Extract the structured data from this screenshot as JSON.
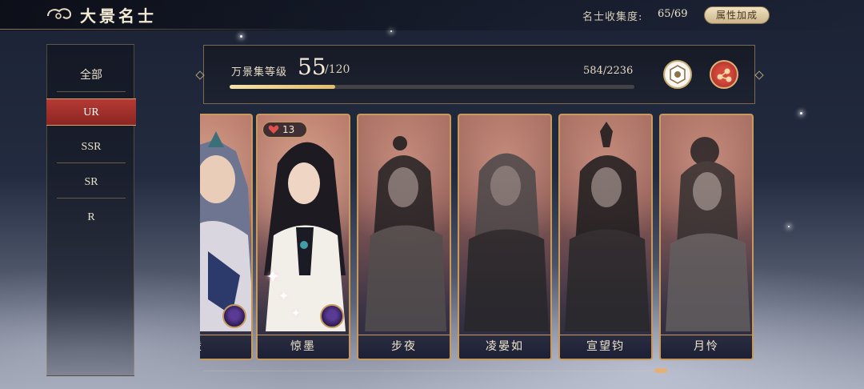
{
  "header": {
    "title": "大景名士",
    "collection_label": "名士收集度:",
    "collection_value": "65/69",
    "attribute_button": "属性加成"
  },
  "sidebar": {
    "items": [
      {
        "label": "全部",
        "active": false
      },
      {
        "label": "UR",
        "active": true
      },
      {
        "label": "SSR",
        "active": false
      },
      {
        "label": "SR",
        "active": false
      },
      {
        "label": "R",
        "active": false
      }
    ]
  },
  "level": {
    "label": "万景集等级",
    "value": "55",
    "max": "/120",
    "exp": "584/2236",
    "exp_progress": 0.26
  },
  "cards": [
    {
      "name": "凌",
      "owned": true,
      "heart": null
    },
    {
      "name": "惊墨",
      "owned": true,
      "heart": "13"
    },
    {
      "name": "步夜",
      "owned": false,
      "heart": null
    },
    {
      "name": "凌晏如",
      "owned": false,
      "heart": null
    },
    {
      "name": "宣望钧",
      "owned": false,
      "heart": null
    },
    {
      "name": "月怜",
      "owned": false,
      "heart": null
    }
  ],
  "colors": {
    "accent_gold": "#c79a5c",
    "active_red": "#b53a34"
  }
}
